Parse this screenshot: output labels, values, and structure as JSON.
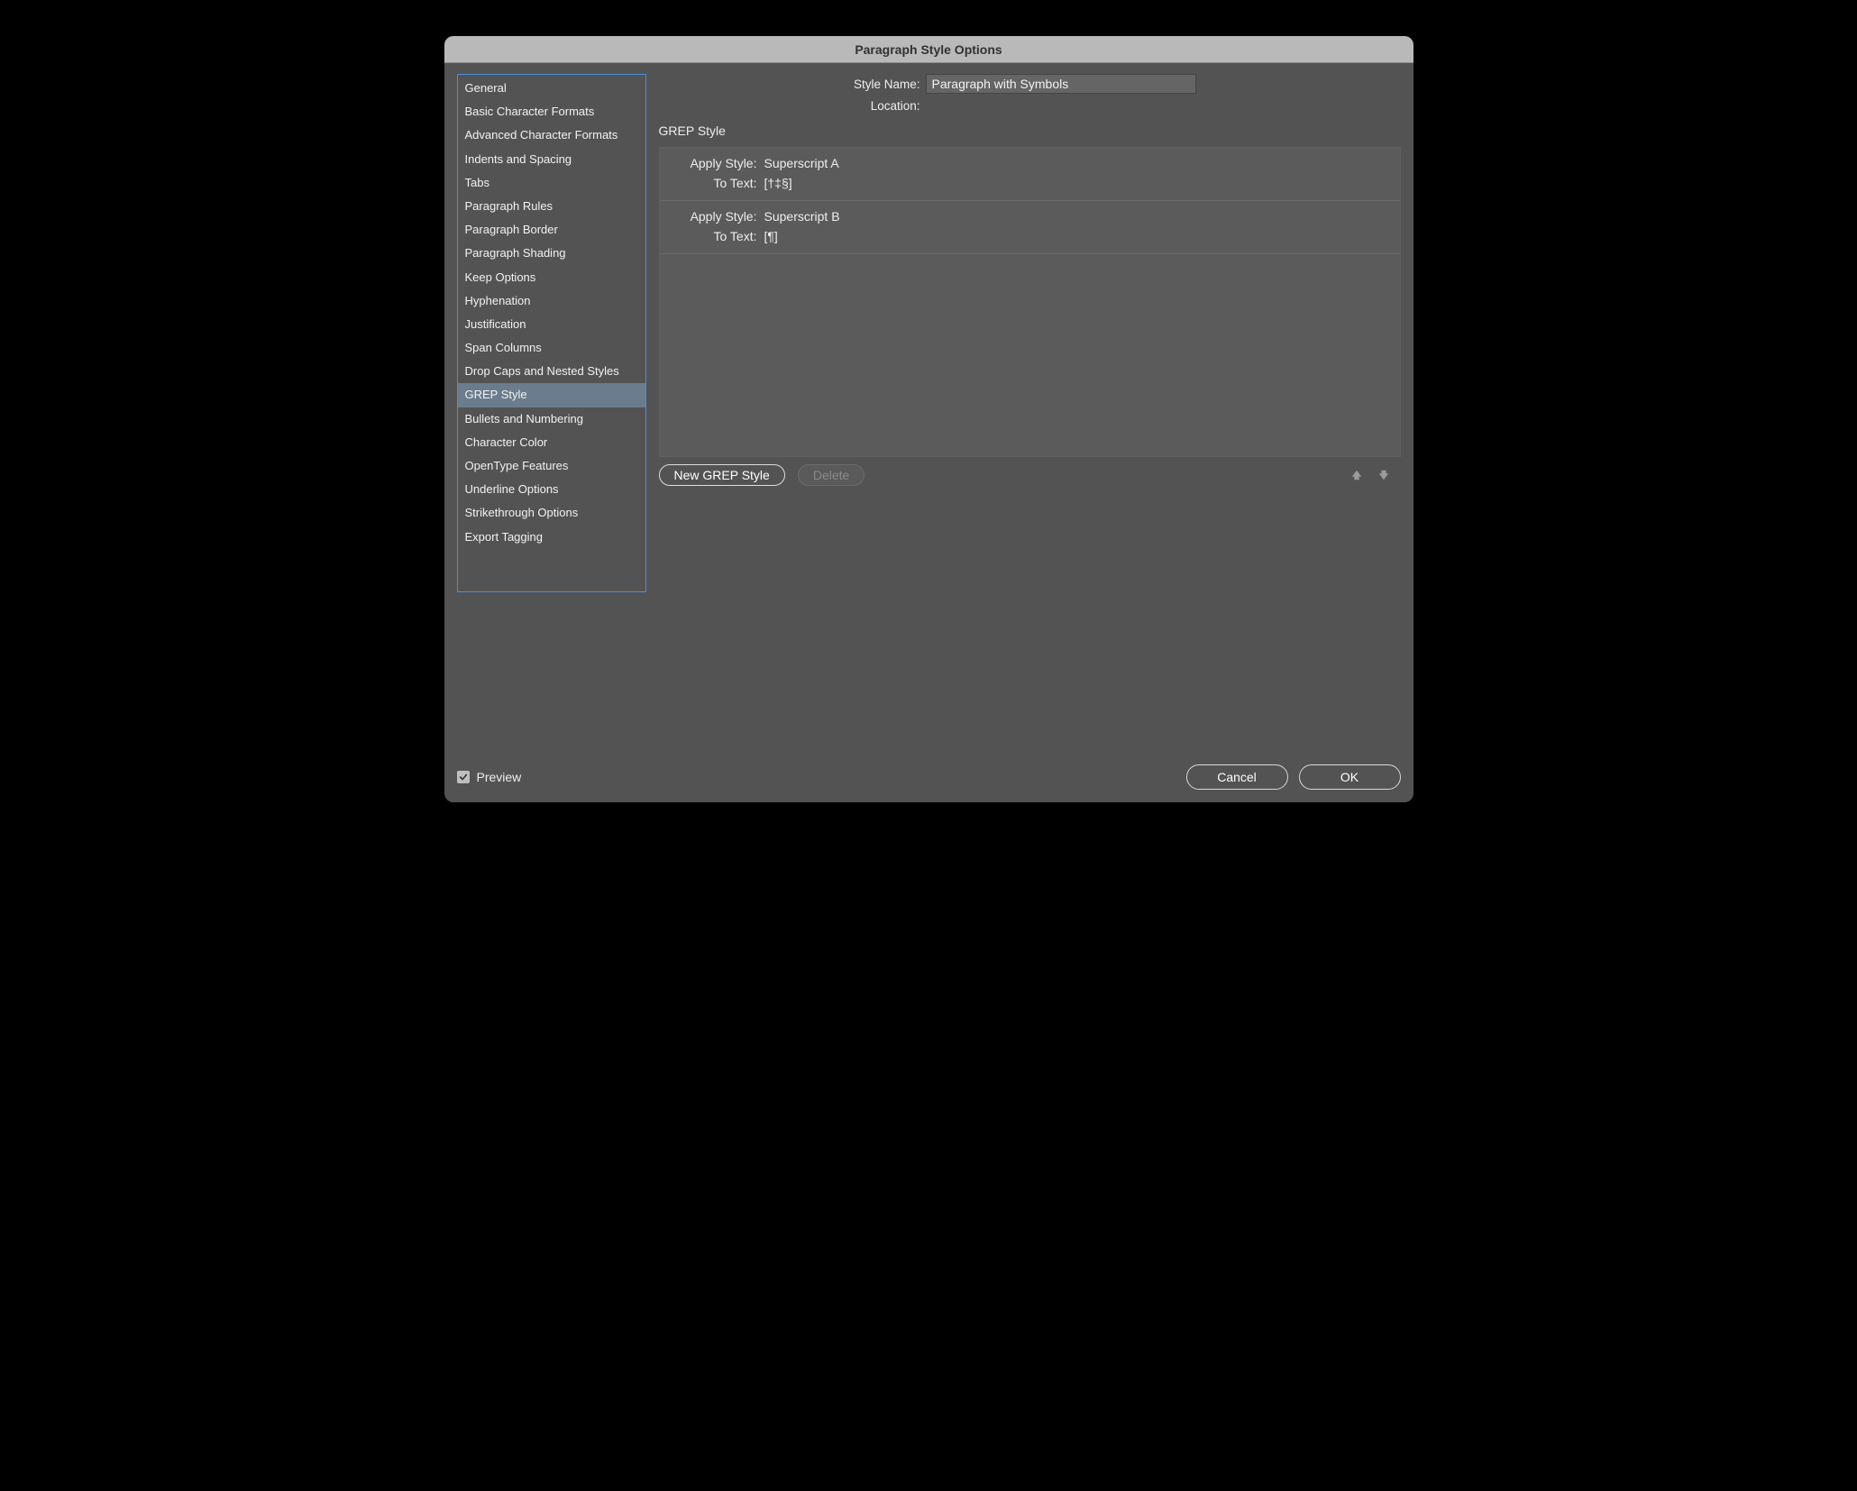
{
  "dialog": {
    "title": "Paragraph Style Options"
  },
  "header": {
    "style_name_label": "Style Name:",
    "style_name_value": "Paragraph with Symbols",
    "location_label": "Location:",
    "location_value": ""
  },
  "sidebar": {
    "items": [
      "General",
      "Basic Character Formats",
      "Advanced Character Formats",
      "Indents and Spacing",
      "Tabs",
      "Paragraph Rules",
      "Paragraph Border",
      "Paragraph Shading",
      "Keep Options",
      "Hyphenation",
      "Justification",
      "Span Columns",
      "Drop Caps and Nested Styles",
      "GREP Style",
      "Bullets and Numbering",
      "Character Color",
      "OpenType Features",
      "Underline Options",
      "Strikethrough Options",
      "Export Tagging"
    ],
    "selected_index": 13
  },
  "main": {
    "section_title": "GREP Style",
    "row_labels": {
      "apply_style": "Apply Style:",
      "to_text": "To Text:"
    },
    "entries": [
      {
        "apply_style": "Superscript A",
        "to_text": "[†‡§]"
      },
      {
        "apply_style": "Superscript B",
        "to_text": "[¶]"
      }
    ],
    "buttons": {
      "new": "New GREP Style",
      "delete": "Delete"
    }
  },
  "footer": {
    "preview_label": "Preview",
    "preview_checked": true,
    "cancel": "Cancel",
    "ok": "OK"
  }
}
